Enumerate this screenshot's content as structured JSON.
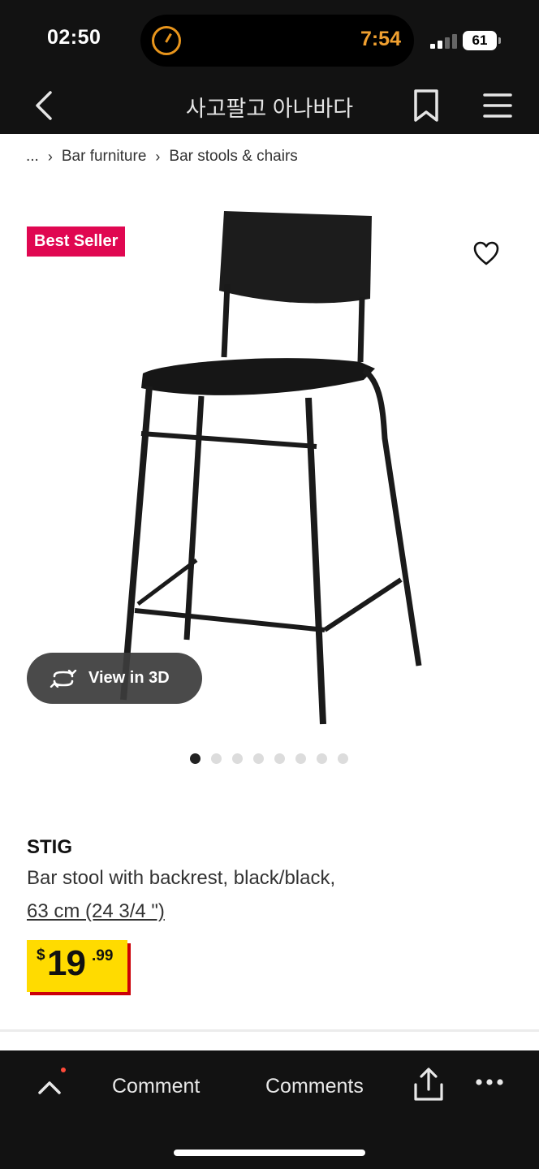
{
  "status_bar": {
    "time": "02:50",
    "timer": "7:54",
    "battery": "61"
  },
  "nav": {
    "title": "사고팔고 아나바다",
    "back_icon": "chevron-left-icon",
    "bookmark_icon": "bookmark-icon",
    "menu_icon": "hamburger-menu-icon"
  },
  "breadcrumb": {
    "ellipsis": "...",
    "items": [
      "Bar furniture",
      "Bar stools & chairs"
    ]
  },
  "product": {
    "badge": "Best Seller",
    "name": "STIG",
    "description": "Bar stool with backrest, black/black,",
    "size": "63 cm (24 3/4 \")",
    "price": {
      "currency": "$",
      "integer": "19",
      "decimal": ".99"
    },
    "view_3d_label": "View in 3D",
    "image_count": 8,
    "active_image": 1,
    "colors": {
      "badge": "#e00751",
      "price_bg": "#ffdb00",
      "price_shadow": "#cc0008"
    }
  },
  "bottom_bar": {
    "comment_label": "Comment",
    "comments_label": "Comments",
    "up_icon": "chevron-up-icon",
    "share_icon": "share-icon",
    "more_icon": "more-horizontal-icon"
  }
}
